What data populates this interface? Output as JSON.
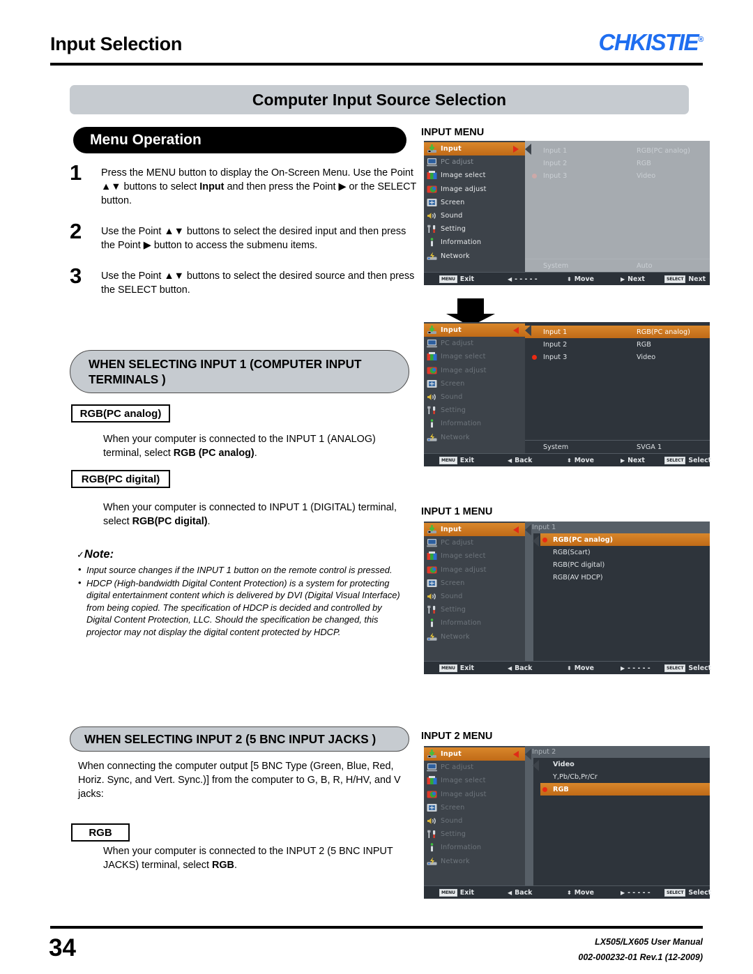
{
  "header": {
    "section_title": "Input Selection",
    "logo_text": "CHKISTIE",
    "logo_reg": "®"
  },
  "banner_title": "Computer Input Source Selection",
  "menu_operation": {
    "title": "Menu Operation"
  },
  "steps": [
    {
      "num": "1",
      "html": "Press the MENU button to display the On-Screen Menu. Use the Point ▲▼ buttons to select <b>Input</b> and then press the Point ▶ or the SELECT button."
    },
    {
      "num": "2",
      "html": "Use the Point ▲▼ buttons to select the desired input and then press the Point ▶ button to access the submenu items."
    },
    {
      "num": "3",
      "html": "Use the Point ▲▼ buttons to select the desired source and then press the SELECT button."
    }
  ],
  "input1_section": {
    "oval_title": "WHEN SELECTING INPUT 1 (COMPUTER INPUT TERMINALS )",
    "rgb_pc_analog_label": "RGB(PC analog)",
    "rgb_pc_analog_text": "When your computer is connected to the INPUT 1 (ANALOG) terminal, select <b>RGB (PC analog)</b>.",
    "rgb_pc_digital_label": "RGB(PC digital)",
    "rgb_pc_digital_text": "When your computer is connected to INPUT 1 (DIGITAL) terminal, select <b>RGB(PC digital)</b>."
  },
  "note": {
    "check": "✓",
    "title": "Note:",
    "items": [
      "Input source changes if the INPUT 1 button on the remote control is pressed.",
      "HDCP (High-bandwidth Digital Content Protection) is a system for protecting digital entertainment content which is delivered by DVI (Digital Visual Interface) from being copied. The specification of HDCP is decided and controlled by Digital Content Protection, LLC. Should the specification be changed, this projector may not display the digital content protected by HDCP."
    ]
  },
  "input2_section": {
    "oval_title": "WHEN SELECTING INPUT 2 (5 BNC INPUT JACKS )",
    "intro_text": "When connecting the computer output [5 BNC Type (Green, Blue, Red, Horiz. Sync, and Vert. Sync.)] from the computer to G, B, R, H/HV, and V jacks:",
    "rgb_label": "RGB",
    "rgb_text": "When your computer is connected to the INPUT 2 (5 BNC INPUT JACKS) terminal, select <b>RGB</b>."
  },
  "osd_labels": {
    "input_menu": "INPUT MENU",
    "input1_menu": "INPUT 1 MENU",
    "input2_menu": "INPUT 2 MENU"
  },
  "osd_sidebar": [
    {
      "label": "Input",
      "icon": "input-icon"
    },
    {
      "label": "PC adjust",
      "icon": "pc-adjust-icon"
    },
    {
      "label": "Image select",
      "icon": "image-select-icon"
    },
    {
      "label": "Image adjust",
      "icon": "image-adjust-icon"
    },
    {
      "label": "Screen",
      "icon": "screen-icon"
    },
    {
      "label": "Sound",
      "icon": "sound-icon"
    },
    {
      "label": "Setting",
      "icon": "setting-icon"
    },
    {
      "label": "Information",
      "icon": "information-icon"
    },
    {
      "label": "Network",
      "icon": "network-icon"
    }
  ],
  "osd1": {
    "rows": [
      {
        "name": "Input 1",
        "value": "RGB(PC analog)",
        "dot": false
      },
      {
        "name": "Input 2",
        "value": "RGB",
        "dot": false
      },
      {
        "name": "Input 3",
        "value": "Video",
        "dot": true
      }
    ],
    "system_label": "System",
    "system_value": "Auto",
    "nav": {
      "exit_key": "MENU",
      "exit": "Exit",
      "back": "- - - - -",
      "move": "Move",
      "next": "Next",
      "select_key": "SELECT",
      "select": "Next"
    }
  },
  "osd2": {
    "rows": [
      {
        "name": "Input 1",
        "value": "RGB(PC analog)",
        "dot": false,
        "highlight": true
      },
      {
        "name": "Input 2",
        "value": "RGB",
        "dot": false,
        "highlight": false
      },
      {
        "name": "Input 3",
        "value": "Video",
        "dot": true,
        "highlight": false
      }
    ],
    "system_label": "System",
    "system_value": "SVGA 1",
    "nav": {
      "exit_key": "MENU",
      "exit": "Exit",
      "back": "Back",
      "move": "Move",
      "next": "Next",
      "select_key": "SELECT",
      "select": "Select"
    }
  },
  "osd_input1": {
    "head": "Input 1",
    "items": [
      {
        "label": "RGB(PC analog)",
        "dot": true,
        "highlight": true
      },
      {
        "label": "RGB(Scart)",
        "dot": false,
        "highlight": false
      },
      {
        "label": "RGB(PC digital)",
        "dot": false,
        "highlight": false
      },
      {
        "label": "RGB(AV HDCP)",
        "dot": false,
        "highlight": false
      }
    ],
    "nav": {
      "exit_key": "MENU",
      "exit": "Exit",
      "back": "Back",
      "move": "Move",
      "next": "- - - - -",
      "select_key": "SELECT",
      "select": "Select"
    }
  },
  "osd_input2": {
    "head": "Input 2",
    "items": [
      {
        "label": "Video",
        "dot": false,
        "highlight": false,
        "bold": true
      },
      {
        "label": "Y,Pb/Cb,Pr/Cr",
        "dot": false,
        "highlight": false,
        "bold": false
      },
      {
        "label": "RGB",
        "dot": true,
        "highlight": true,
        "bold": true
      }
    ],
    "nav": {
      "exit_key": "MENU",
      "exit": "Exit",
      "back": "Back",
      "move": "Move",
      "next": "- - - - -",
      "select_key": "SELECT",
      "select": "Select"
    }
  },
  "footer": {
    "page_number": "34",
    "manual": "LX505/LX605 User Manual",
    "doc_id": "002-000232-01 Rev.1 (12-2009)"
  },
  "colors": {
    "accent_orange": "#c06a17",
    "brand_blue": "#1f6ef0",
    "osd_panel": "#2e343b",
    "osd_sidebar": "#3d434a",
    "red_marker": "#ea2a13",
    "banner_gray": "#c6cbd0"
  }
}
